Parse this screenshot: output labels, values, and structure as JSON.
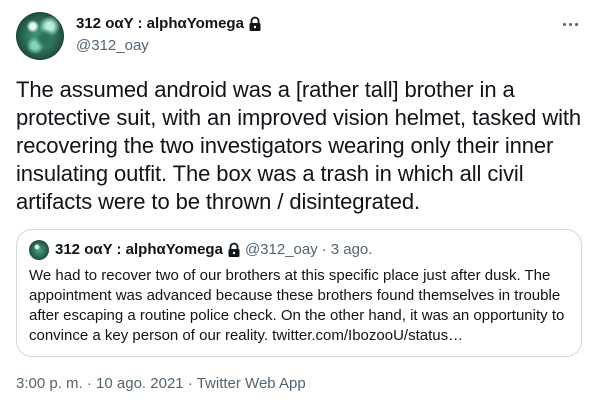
{
  "author": {
    "display_name": "312 oαY : alphαYomega",
    "handle": "@312_oay"
  },
  "icons": {
    "avatar": "avatar-image",
    "lock": "lock-icon",
    "more": "more-horizontal-icon"
  },
  "tweet": {
    "text": "The assumed android was a [rather tall] brother in a protective suit, with an improved vision helmet, tasked with recovering the two investigators wearing only their inner insulating outfit. The box was a trash in which all civil artifacts were to be thrown / disintegrated."
  },
  "quote": {
    "display_name": "312 oαY : alphαYomega",
    "handle": "@312_oay",
    "separator": "·",
    "time_ago": "3 ago.",
    "text": "We had to recover two of our brothers at this specific place just after dusk. The appointment was advanced because these brothers found themselves in trouble after escaping a routine police check. On the other hand, it was an opportunity to convince a key person of our reality. twitter.com/IbozooU/status…"
  },
  "footer": {
    "time": "3:00 p. m.",
    "separator1": "·",
    "date": "10 ago. 2021",
    "separator2": "·",
    "source": "Twitter Web App"
  },
  "colors": {
    "text": "#0f1419",
    "secondary": "#536471",
    "border": "#cfd9de",
    "background": "#ffffff"
  }
}
